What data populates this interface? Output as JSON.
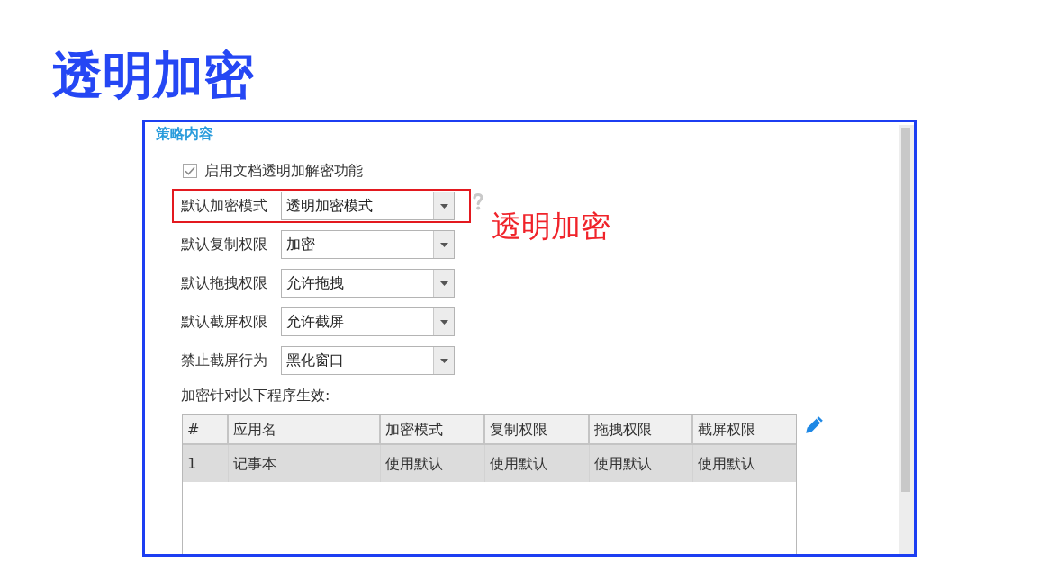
{
  "slide_title": "透明加密",
  "panel": {
    "section_title": "策略内容",
    "enable_option": {
      "label": "启用文档透明加解密功能",
      "checked": true
    },
    "settings": [
      {
        "label": "默认加密模式",
        "value": "透明加密模式",
        "highlighted": true,
        "help": true
      },
      {
        "label": "默认复制权限",
        "value": "加密",
        "highlighted": false,
        "help": false
      },
      {
        "label": "默认拖拽权限",
        "value": "允许拖拽",
        "highlighted": false,
        "help": false
      },
      {
        "label": "默认截屏权限",
        "value": "允许截屏",
        "highlighted": false,
        "help": false
      },
      {
        "label": "禁止截屏行为",
        "value": "黑化窗口",
        "highlighted": false,
        "help": false
      }
    ],
    "programs_label": "加密针对以下程序生效:",
    "program_table": {
      "columns": [
        "#",
        "应用名",
        "加密模式",
        "复制权限",
        "拖拽权限",
        "截屏权限"
      ],
      "rows": [
        {
          "cells": [
            "1",
            "记事本",
            "使用默认",
            "使用默认",
            "使用默认",
            "使用默认"
          ],
          "selected": true
        }
      ]
    }
  },
  "annotation": {
    "text": "透明加密"
  }
}
